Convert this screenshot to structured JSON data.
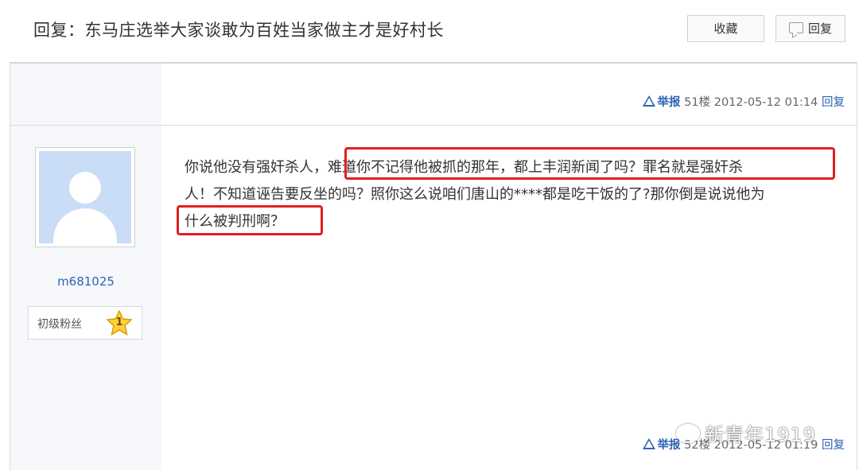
{
  "header": {
    "title": "回复：东马庄选举大家谈敢为百姓当家做主才是好村长",
    "favorite_label": "收藏",
    "reply_label": "回复"
  },
  "post_prev": {
    "report_label": "举报",
    "floor": "51楼",
    "datetime": "2012-05-12 01:14",
    "reply_label": "回复"
  },
  "post": {
    "username": "m681025",
    "rank_label": "初级粉丝",
    "rank_level": "1",
    "content_lines": [
      "你说他没有强奸杀人，难道你不记得他被抓的那年，都上丰润新闻了吗？罪名就是强奸杀",
      "人！不知道诬告要反坐的吗？照你这么说咱们唐山的****都是吃干饭的了?那你倒是说说他为",
      "什么被判刑啊？"
    ]
  },
  "post_next": {
    "report_label": "举报",
    "floor": "52楼",
    "datetime": "2012-05-12 01:19",
    "reply_label": "回复"
  },
  "watermark": {
    "text": "新青年1919"
  },
  "colors": {
    "link": "#2d64b3",
    "highlight": "#e02020",
    "avatar_bg": "#c9ddf7"
  }
}
